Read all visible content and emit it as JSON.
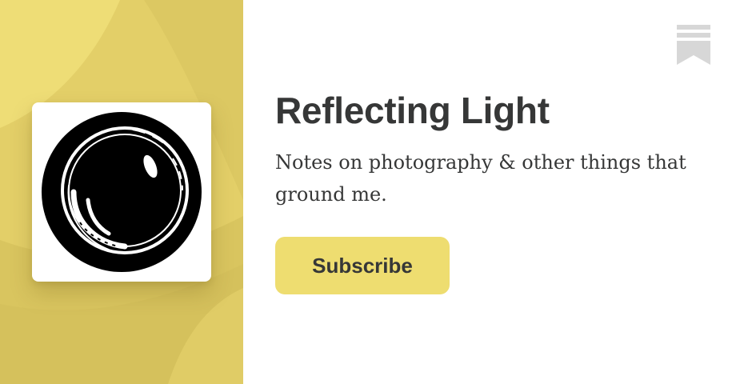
{
  "publication": {
    "title": "Reflecting Light",
    "description": "Notes on photography & other things that ground me."
  },
  "subscribe": {
    "label": "Subscribe"
  },
  "icons": {
    "corner": "bookmark-icon",
    "logo": "camera-lens-icon"
  },
  "colors": {
    "panel_background": "#e6d26c",
    "button_background": "#eedd70",
    "text": "#363737",
    "bookmark_icon": "#d7d7d7"
  }
}
